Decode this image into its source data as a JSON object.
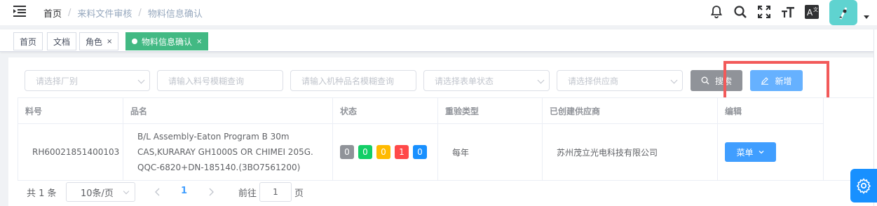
{
  "header": {
    "breadcrumb": [
      "首页",
      "来料文件审核",
      "物料信息确认"
    ],
    "icons": [
      "hamburger-icon",
      "bell-icon",
      "search-icon",
      "fullscreen-icon",
      "font-size-icon",
      "translate-icon"
    ]
  },
  "tags": [
    {
      "label": "首页",
      "closable": false,
      "active": false
    },
    {
      "label": "文档",
      "closable": false,
      "active": false
    },
    {
      "label": "角色",
      "closable": true,
      "active": false
    },
    {
      "label": "物料信息确认",
      "closable": true,
      "active": true
    }
  ],
  "tag_close": "×",
  "filters": {
    "factory_placeholder": "请选择厂别",
    "part_placeholder": "请输入料号模糊查询",
    "model_placeholder": "请输入机种品名模糊查询",
    "status_placeholder": "请选择表单状态",
    "supplier_placeholder": "请选择供应商",
    "search_label": "搜索",
    "add_label": "新增"
  },
  "table": {
    "headers": [
      "料号",
      "品名",
      "状态",
      "重验类型",
      "已创建供应商",
      "编辑"
    ],
    "rows": [
      {
        "part_no": "RH60021851400103",
        "name": "B/L Assembly-Eaton Program B 30m CAS,KURARAY GH1000S OR CHIMEI 205G. QQC-6820+DN-185140.(3BO7561200)",
        "status_counts": [
          {
            "value": "0",
            "color": "#909399"
          },
          {
            "value": "0",
            "color": "#13ce66"
          },
          {
            "value": "0",
            "color": "#ffba00"
          },
          {
            "value": "1",
            "color": "#ff4949"
          },
          {
            "value": "0",
            "color": "#1890ff"
          }
        ],
        "recheck_type": "每年",
        "suppliers": "苏州茂立光电科技有限公司",
        "menu_label": "菜单"
      }
    ]
  },
  "pagination": {
    "total": "共 1 条",
    "page_size": "10条/页",
    "current_page": "1",
    "goto_prefix": "前往",
    "goto_value": "1",
    "goto_suffix": "页"
  },
  "colors": {
    "accent": "#409eff",
    "tag_active": "#42b983",
    "highlight": "#f25a5a"
  }
}
